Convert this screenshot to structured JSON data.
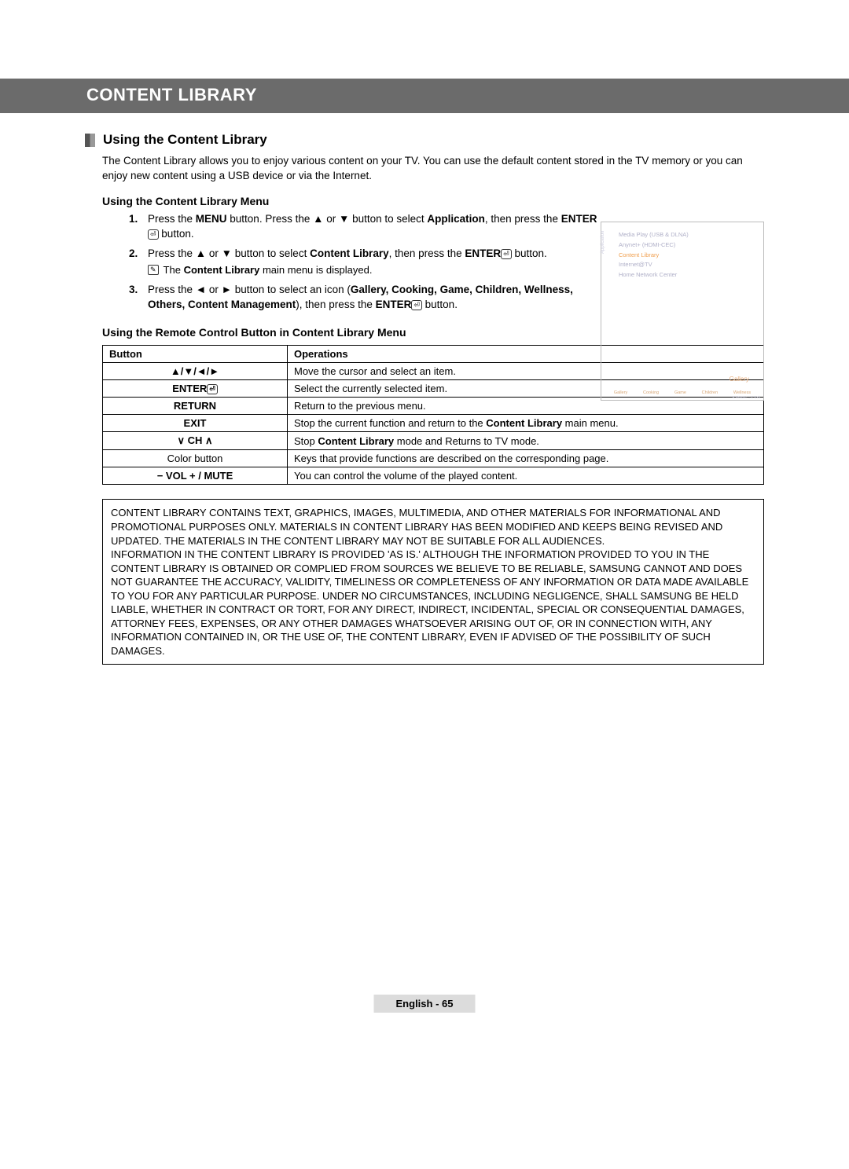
{
  "header": {
    "title": "CONTENT LIBRARY"
  },
  "section": {
    "heading": "Using the Content Library",
    "intro": "The Content Library allows you to enjoy various content on your TV. You can use the default content stored in the TV memory or you can enjoy new content using a USB device or via the Internet."
  },
  "menu_usage": {
    "subhead": "Using the Content Library Menu",
    "steps": {
      "s1": {
        "pre": "Press the ",
        "menu": "MENU",
        "mid1": " button. Press the ▲ or ▼ button to select ",
        "app": "Application",
        "mid2": ", then press the ",
        "enter": "ENTER",
        "post": " button."
      },
      "s2": {
        "pre": "Press the ▲ or ▼ button to select ",
        "cl": "Content Library",
        "mid": ", then press the ",
        "enter": "ENTER",
        "post": " button.",
        "note_pre": "The ",
        "note_bold": "Content Library",
        "note_post": " main menu is displayed."
      },
      "s3": {
        "pre": "Press the ◄ or ► button to select an icon (",
        "bold": "Gallery, Cooking, Game, Children, Wellness, Others, Content Management",
        "mid": "), then press the ",
        "enter": "ENTER",
        "post": " button."
      }
    }
  },
  "figure": {
    "app_label": "Application",
    "row1": "Media Play (USB & DLNA)",
    "row2": "Anynet+ (HDMI-CEC)",
    "row3": "Content Library",
    "row4": "Internet@TV",
    "row5": "Home Network Center",
    "gallery": "Gallery",
    "icons": {
      "i1": "Gallery",
      "i2": "Cooking",
      "i3": "Game",
      "i4": "Children",
      "i5": "Wellness"
    },
    "hint": "R Return   →E Exit"
  },
  "remote": {
    "subhead": "Using the Remote Control Button in Content Library Menu",
    "headers": {
      "c1": "Button",
      "c2": "Operations"
    },
    "rows": {
      "r1": {
        "btn": "▲/▼/◄/►",
        "op": "Move the cursor and select an item."
      },
      "r2": {
        "btn": "ENTER",
        "op": "Select the currently selected item."
      },
      "r3": {
        "btn": "RETURN",
        "op": "Return to the previous menu."
      },
      "r4": {
        "btn": "EXIT",
        "op_pre": "Stop the current function and return to the ",
        "op_bold": "Content Library",
        "op_post": " main menu."
      },
      "r5": {
        "btn": "∨ CH ∧",
        "op_pre": "Stop ",
        "op_bold": "Content Library",
        "op_post": " mode and Returns to TV mode."
      },
      "r6": {
        "btn": "Color button",
        "op": "Keys that provide functions are described on the corresponding page."
      },
      "r7": {
        "btn": "− VOL +  / MUTE",
        "op": "You can control the volume of the played content."
      }
    }
  },
  "disclaimer": {
    "p1": "CONTENT LIBRARY CONTAINS TEXT, GRAPHICS, IMAGES, MULTIMEDIA, AND OTHER MATERIALS FOR INFORMATIONAL AND PROMOTIONAL PURPOSES ONLY. MATERIALS IN CONTENT LIBRARY HAS BEEN MODIFIED AND KEEPS BEING REVISED AND UPDATED. THE MATERIALS IN THE CONTENT LIBRARY MAY NOT BE SUITABLE FOR ALL AUDIENCES.",
    "p2": "INFORMATION IN THE CONTENT LIBRARY IS PROVIDED 'AS IS.' ALTHOUGH THE INFORMATION PROVIDED TO YOU IN THE CONTENT LIBRARY IS OBTAINED OR COMPLIED FROM SOURCES WE BELIEVE TO BE RELIABLE, SAMSUNG CANNOT AND DOES NOT GUARANTEE THE ACCURACY, VALIDITY, TIMELINESS OR COMPLETENESS OF ANY INFORMATION OR DATA MADE AVAILABLE TO YOU FOR ANY PARTICULAR PURPOSE. UNDER NO CIRCUMSTANCES, INCLUDING NEGLIGENCE, SHALL SAMSUNG BE HELD LIABLE, WHETHER IN CONTRACT OR TORT, FOR ANY DIRECT, INDIRECT, INCIDENTAL, SPECIAL OR CONSEQUENTIAL DAMAGES, ATTORNEY FEES, EXPENSES, OR ANY OTHER DAMAGES WHATSOEVER ARISING OUT OF, OR IN CONNECTION WITH, ANY INFORMATION CONTAINED IN, OR THE USE OF, THE CONTENT LIBRARY, EVEN IF ADVISED OF THE POSSIBILITY OF SUCH DAMAGES."
  },
  "footer": {
    "text": "English - 65"
  }
}
